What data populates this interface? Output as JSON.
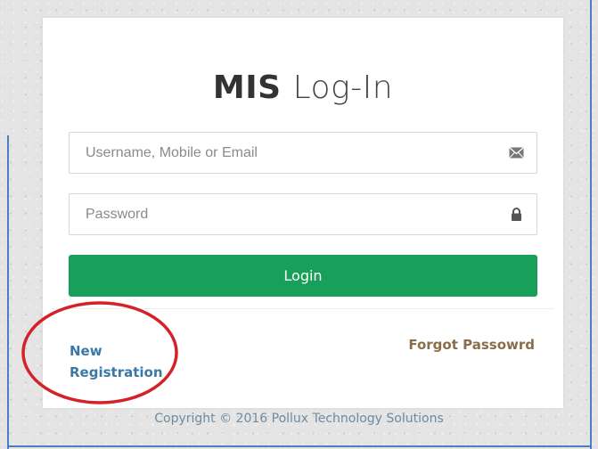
{
  "title": {
    "bold": "MIS",
    "light": "Log-In"
  },
  "username": {
    "placeholder": "Username, Mobile or Email",
    "value": "",
    "icon": "envelope-icon"
  },
  "password": {
    "placeholder": "Password",
    "value": "",
    "icon": "lock-icon"
  },
  "login_button": {
    "label": "Login"
  },
  "links": {
    "new_registration_line1": "New",
    "new_registration_line2": "Registration",
    "forgot_password": "Forgot Passowrd"
  },
  "footer": {
    "copyright": "Copyright © 2016 Pollux Technology Solutions"
  },
  "colors": {
    "login_button": "#18a05a",
    "new_registration_link": "#3a78a6",
    "forgot_password_link": "#8a6d4a",
    "highlight_ellipse": "#d4222a",
    "frame": "#4a7fc1"
  }
}
